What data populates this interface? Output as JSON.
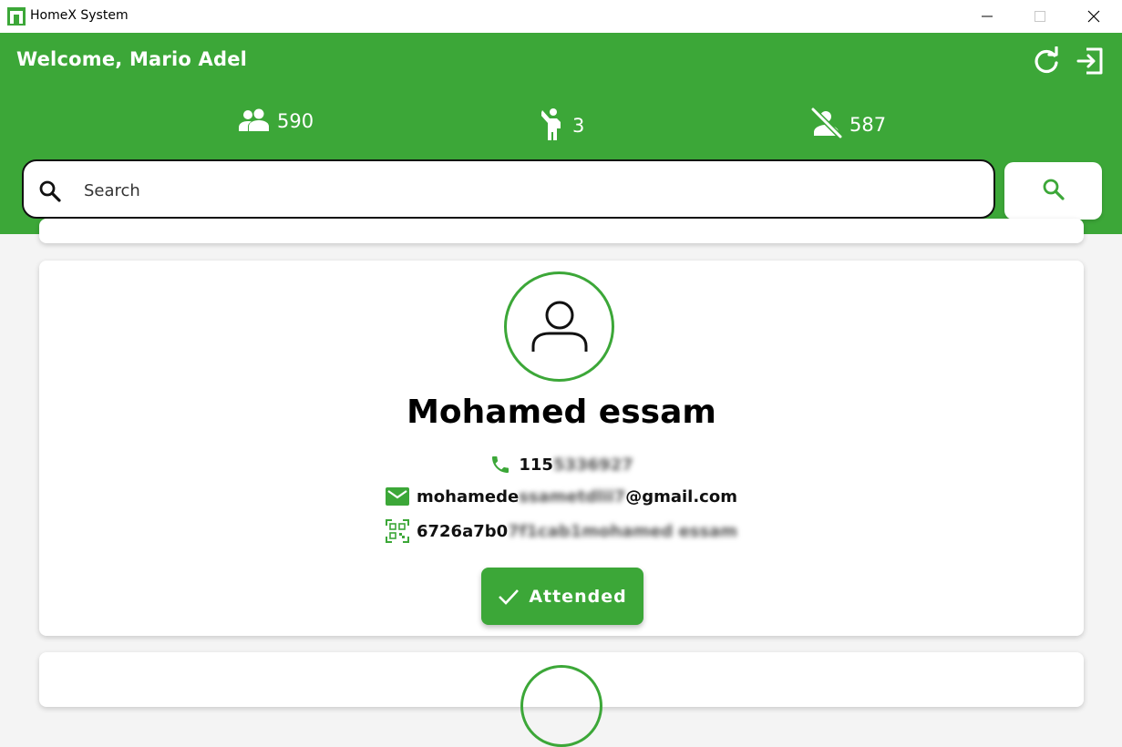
{
  "window": {
    "title": "HomeX System",
    "accent_color": "#3ca738"
  },
  "header": {
    "welcome": "Welcome, Mario Adel",
    "refresh_icon": "refresh-icon",
    "logout_icon": "logout-icon"
  },
  "stats": {
    "total": "590",
    "attended": "3",
    "absent": "587"
  },
  "search": {
    "placeholder": "Search",
    "value": ""
  },
  "card": {
    "name": "Mohamed essam",
    "phone_visible": "115",
    "phone_hidden": "5336927",
    "email_visible": "mohamede",
    "email_hidden": "ssametdlii7",
    "email_domain": "@gmail.com",
    "code_visible": "6726a7b0",
    "code_hidden": "7f1cab1mohamed essam",
    "status_label": "Attended"
  }
}
